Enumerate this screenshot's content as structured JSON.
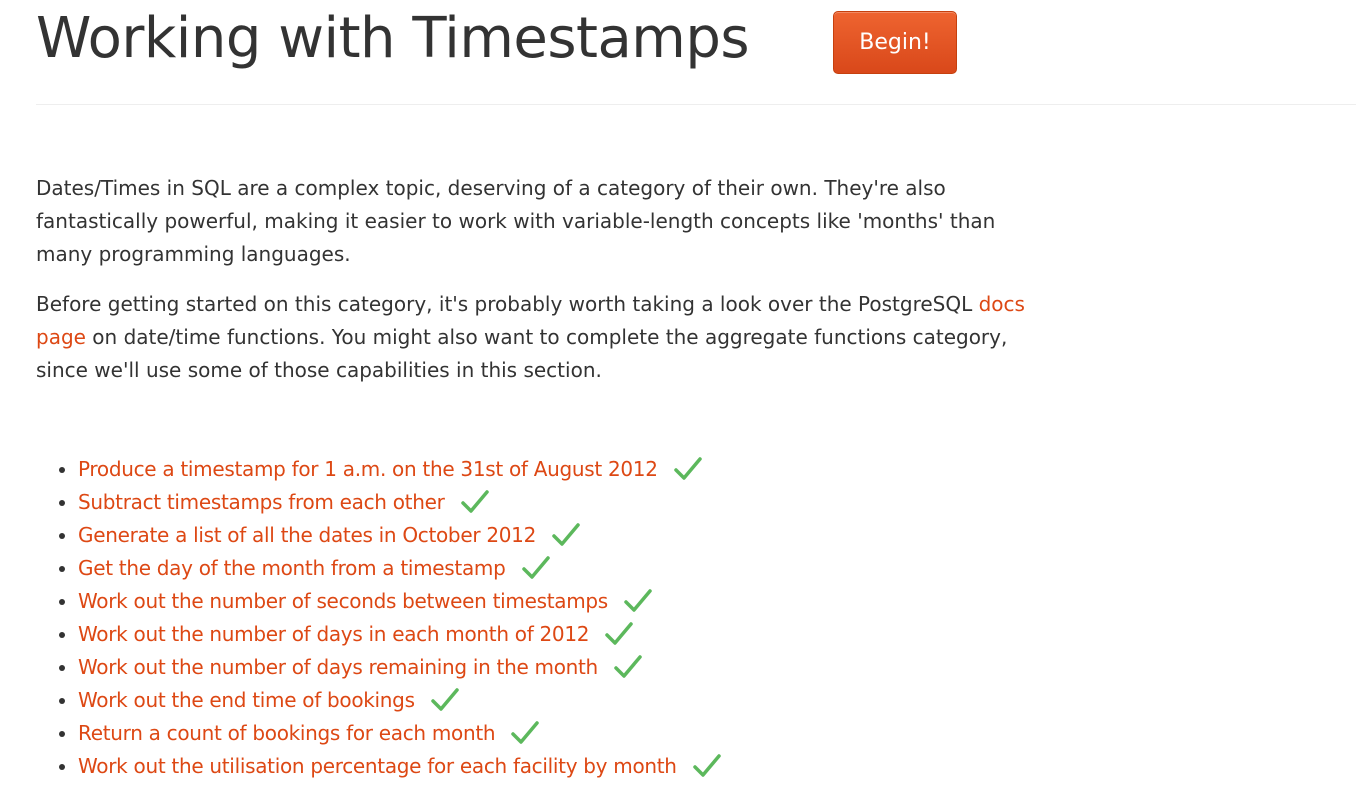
{
  "header": {
    "title": "Working with Timestamps",
    "begin_label": "Begin!"
  },
  "intro": {
    "paragraph1": "Dates/Times in SQL are a complex topic, deserving of a category of their own. They're also fantastically powerful, making it easier to work with variable-length concepts like 'months' than many programming languages.",
    "paragraph2_before": "Before getting started on this category, it's probably worth taking a look over the PostgreSQL ",
    "paragraph2_link": "docs page",
    "paragraph2_after": " on date/time functions. You might also want to complete the aggregate functions category, since we'll use some of those capabilities in this section."
  },
  "exercises": [
    {
      "label": "Produce a timestamp for 1 a.m. on the 31st of August 2012",
      "completed": true
    },
    {
      "label": "Subtract timestamps from each other",
      "completed": true
    },
    {
      "label": "Generate a list of all the dates in October 2012",
      "completed": true
    },
    {
      "label": "Get the day of the month from a timestamp",
      "completed": true
    },
    {
      "label": "Work out the number of seconds between timestamps",
      "completed": true
    },
    {
      "label": "Work out the number of days in each month of 2012",
      "completed": true
    },
    {
      "label": "Work out the number of days remaining in the month",
      "completed": true
    },
    {
      "label": "Work out the end time of bookings",
      "completed": true
    },
    {
      "label": "Return a count of bookings for each month",
      "completed": true
    },
    {
      "label": "Work out the utilisation percentage for each facility by month",
      "completed": true
    }
  ],
  "colors": {
    "link": "#dd4814",
    "check": "#5cb85c",
    "button": "#e55a25"
  },
  "icons": {
    "check": "check-icon"
  }
}
